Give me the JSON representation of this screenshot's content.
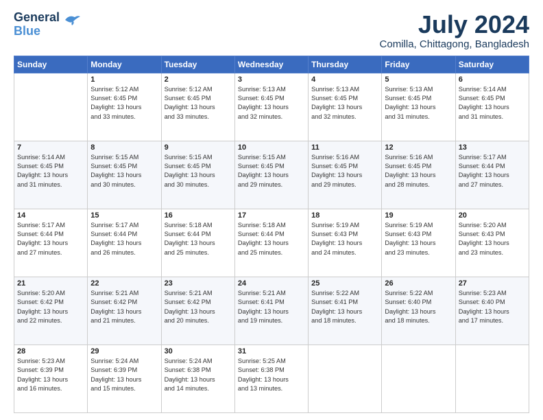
{
  "logo": {
    "line1": "General",
    "line2": "Blue"
  },
  "title": "July 2024",
  "subtitle": "Comilla, Chittagong, Bangladesh",
  "weekdays": [
    "Sunday",
    "Monday",
    "Tuesday",
    "Wednesday",
    "Thursday",
    "Friday",
    "Saturday"
  ],
  "weeks": [
    [
      {
        "day": "",
        "info": ""
      },
      {
        "day": "1",
        "info": "Sunrise: 5:12 AM\nSunset: 6:45 PM\nDaylight: 13 hours\nand 33 minutes."
      },
      {
        "day": "2",
        "info": "Sunrise: 5:12 AM\nSunset: 6:45 PM\nDaylight: 13 hours\nand 33 minutes."
      },
      {
        "day": "3",
        "info": "Sunrise: 5:13 AM\nSunset: 6:45 PM\nDaylight: 13 hours\nand 32 minutes."
      },
      {
        "day": "4",
        "info": "Sunrise: 5:13 AM\nSunset: 6:45 PM\nDaylight: 13 hours\nand 32 minutes."
      },
      {
        "day": "5",
        "info": "Sunrise: 5:13 AM\nSunset: 6:45 PM\nDaylight: 13 hours\nand 31 minutes."
      },
      {
        "day": "6",
        "info": "Sunrise: 5:14 AM\nSunset: 6:45 PM\nDaylight: 13 hours\nand 31 minutes."
      }
    ],
    [
      {
        "day": "7",
        "info": "Sunrise: 5:14 AM\nSunset: 6:45 PM\nDaylight: 13 hours\nand 31 minutes."
      },
      {
        "day": "8",
        "info": "Sunrise: 5:15 AM\nSunset: 6:45 PM\nDaylight: 13 hours\nand 30 minutes."
      },
      {
        "day": "9",
        "info": "Sunrise: 5:15 AM\nSunset: 6:45 PM\nDaylight: 13 hours\nand 30 minutes."
      },
      {
        "day": "10",
        "info": "Sunrise: 5:15 AM\nSunset: 6:45 PM\nDaylight: 13 hours\nand 29 minutes."
      },
      {
        "day": "11",
        "info": "Sunrise: 5:16 AM\nSunset: 6:45 PM\nDaylight: 13 hours\nand 29 minutes."
      },
      {
        "day": "12",
        "info": "Sunrise: 5:16 AM\nSunset: 6:45 PM\nDaylight: 13 hours\nand 28 minutes."
      },
      {
        "day": "13",
        "info": "Sunrise: 5:17 AM\nSunset: 6:44 PM\nDaylight: 13 hours\nand 27 minutes."
      }
    ],
    [
      {
        "day": "14",
        "info": "Sunrise: 5:17 AM\nSunset: 6:44 PM\nDaylight: 13 hours\nand 27 minutes."
      },
      {
        "day": "15",
        "info": "Sunrise: 5:17 AM\nSunset: 6:44 PM\nDaylight: 13 hours\nand 26 minutes."
      },
      {
        "day": "16",
        "info": "Sunrise: 5:18 AM\nSunset: 6:44 PM\nDaylight: 13 hours\nand 25 minutes."
      },
      {
        "day": "17",
        "info": "Sunrise: 5:18 AM\nSunset: 6:44 PM\nDaylight: 13 hours\nand 25 minutes."
      },
      {
        "day": "18",
        "info": "Sunrise: 5:19 AM\nSunset: 6:43 PM\nDaylight: 13 hours\nand 24 minutes."
      },
      {
        "day": "19",
        "info": "Sunrise: 5:19 AM\nSunset: 6:43 PM\nDaylight: 13 hours\nand 23 minutes."
      },
      {
        "day": "20",
        "info": "Sunrise: 5:20 AM\nSunset: 6:43 PM\nDaylight: 13 hours\nand 23 minutes."
      }
    ],
    [
      {
        "day": "21",
        "info": "Sunrise: 5:20 AM\nSunset: 6:42 PM\nDaylight: 13 hours\nand 22 minutes."
      },
      {
        "day": "22",
        "info": "Sunrise: 5:21 AM\nSunset: 6:42 PM\nDaylight: 13 hours\nand 21 minutes."
      },
      {
        "day": "23",
        "info": "Sunrise: 5:21 AM\nSunset: 6:42 PM\nDaylight: 13 hours\nand 20 minutes."
      },
      {
        "day": "24",
        "info": "Sunrise: 5:21 AM\nSunset: 6:41 PM\nDaylight: 13 hours\nand 19 minutes."
      },
      {
        "day": "25",
        "info": "Sunrise: 5:22 AM\nSunset: 6:41 PM\nDaylight: 13 hours\nand 18 minutes."
      },
      {
        "day": "26",
        "info": "Sunrise: 5:22 AM\nSunset: 6:40 PM\nDaylight: 13 hours\nand 18 minutes."
      },
      {
        "day": "27",
        "info": "Sunrise: 5:23 AM\nSunset: 6:40 PM\nDaylight: 13 hours\nand 17 minutes."
      }
    ],
    [
      {
        "day": "28",
        "info": "Sunrise: 5:23 AM\nSunset: 6:39 PM\nDaylight: 13 hours\nand 16 minutes."
      },
      {
        "day": "29",
        "info": "Sunrise: 5:24 AM\nSunset: 6:39 PM\nDaylight: 13 hours\nand 15 minutes."
      },
      {
        "day": "30",
        "info": "Sunrise: 5:24 AM\nSunset: 6:38 PM\nDaylight: 13 hours\nand 14 minutes."
      },
      {
        "day": "31",
        "info": "Sunrise: 5:25 AM\nSunset: 6:38 PM\nDaylight: 13 hours\nand 13 minutes."
      },
      {
        "day": "",
        "info": ""
      },
      {
        "day": "",
        "info": ""
      },
      {
        "day": "",
        "info": ""
      }
    ]
  ]
}
